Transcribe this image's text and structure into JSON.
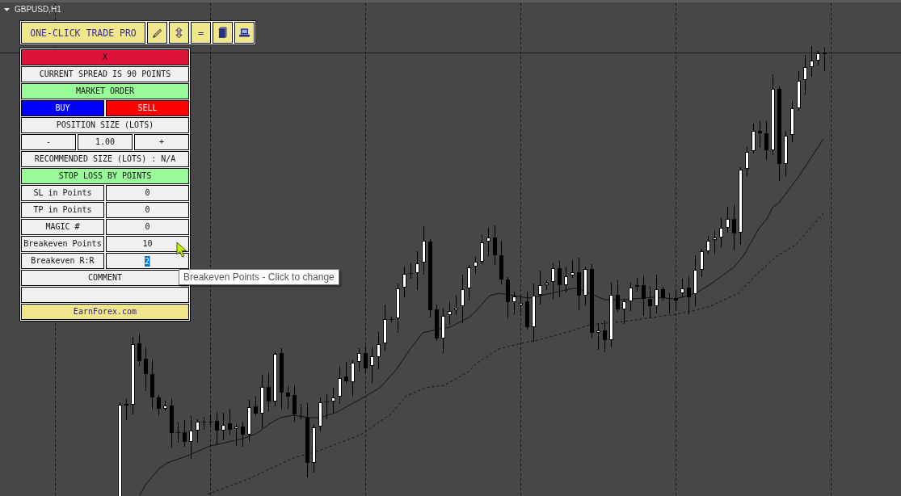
{
  "chart": {
    "title": "GBPUSD,H1"
  },
  "toolbar": {
    "title_button": "ONE-CLICK TRADE PRO",
    "equals_button": "="
  },
  "panel": {
    "close_button": "X",
    "spread_info": "CURRENT SPREAD IS 90 POINTS",
    "order_type_button": "MARKET ORDER",
    "buy_button": "BUY",
    "sell_button": "SELL",
    "position_size_label": "POSITION SIZE (LOTS)",
    "decrease_button": "-",
    "lots_field": "1.00",
    "increase_button": "+",
    "recommended_size": "RECOMMENDED SIZE (LOTS) : N/A",
    "stop_loss_mode_button": "STOP LOSS BY POINTS",
    "settings": [
      {
        "label": "SL in Points",
        "value": "0",
        "text_selected": false
      },
      {
        "label": "TP in Points",
        "value": "0",
        "text_selected": false
      },
      {
        "label": "MAGIC #",
        "value": "0",
        "text_selected": false
      },
      {
        "label": "Breakeven Points",
        "value": "10",
        "text_selected": false
      },
      {
        "label": "Breakeven R:R",
        "value": "2",
        "text_selected": true
      }
    ],
    "comment_label": "COMMENT",
    "website_button": "EarnForex.com"
  },
  "tooltip": "Breakeven Points - Click to change"
}
